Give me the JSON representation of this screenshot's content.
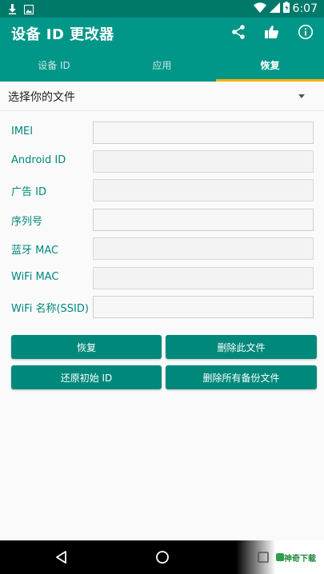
{
  "status_bar": {
    "time": "6:07",
    "left_icons": [
      "download-icon",
      "image-icon"
    ],
    "right_icons": [
      "wifi-icon",
      "signal-icon",
      "battery-icon"
    ]
  },
  "app_bar": {
    "title": "设备 ID 更改器",
    "actions": [
      "share-icon",
      "thumbs-up-icon",
      "info-icon"
    ]
  },
  "tabs": [
    {
      "label": "设备 ID",
      "active": false
    },
    {
      "label": "应用",
      "active": false
    },
    {
      "label": "恢复",
      "active": true
    }
  ],
  "file_select": {
    "label": "选择你的文件"
  },
  "fields": [
    {
      "label": "IMEI",
      "value": ""
    },
    {
      "label": "Android ID",
      "value": ""
    },
    {
      "label": "广告 ID",
      "value": ""
    },
    {
      "label": "序列号",
      "value": ""
    },
    {
      "label": "蓝牙 MAC",
      "value": ""
    },
    {
      "label": "WiFi MAC",
      "value": ""
    },
    {
      "label": "WiFi 名称(SSID)",
      "value": ""
    }
  ],
  "buttons": {
    "restore": "恢复",
    "delete_file": "删除此文件",
    "restore_original": "还原初始 ID",
    "delete_all_backups": "删除所有备份文件"
  },
  "watermark": {
    "text": "神奇下载"
  },
  "colors": {
    "primary": "#009688",
    "primary_dark": "#00796b",
    "button": "#00897b",
    "tab_indicator": "#ffb300",
    "label_text": "#00897b"
  }
}
